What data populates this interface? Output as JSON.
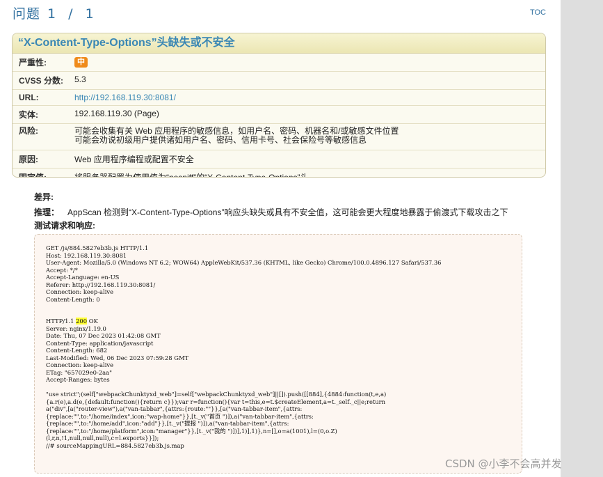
{
  "header": {
    "title": "问题",
    "counter": "1 / 1",
    "toc_label": "TOC"
  },
  "issue": {
    "title": "“X-Content-Type-Options”头缺失或不安全",
    "rows": {
      "severity": {
        "label": "严重性:",
        "value": "中"
      },
      "cvss": {
        "label": "CVSS 分数:",
        "value": "5.3"
      },
      "url": {
        "label": "URL:",
        "value": "http://192.168.119.30:8081/"
      },
      "entity": {
        "label": "实体:",
        "value": "192.168.119.30 (Page)"
      },
      "risk": {
        "label": "风险:",
        "line1": "可能会收集有关 Web 应用程序的敏感信息，如用户名、密码、机器名和/或敏感文件位置",
        "line2": "可能会劝说初级用户提供诸如用户名、密码、信用卡号、社会保险号等敏感信息"
      },
      "cause": {
        "label": "原因:",
        "value": "Web 应用程序编程或配置不安全"
      },
      "fix": {
        "label": "固定值:",
        "value": "将服务器配置为使用值为“nosniff”的“X-Content-Type-Options”头"
      }
    }
  },
  "diff": {
    "label": "差异:"
  },
  "reasoning": {
    "label": "推理：",
    "text": "AppScan 检测到“X-Content-Type-Options”响应头缺失或具有不安全值，这可能会更大程度地暴露于偷渡式下载攻击之下"
  },
  "test": {
    "label": "测试请求和响应:"
  },
  "request": {
    "lines": [
      "GET /js/884.5827eb3b.js HTTP/1.1",
      "Host: 192.168.119.30:8081",
      "User-Agent: Mozilla/5.0 (Windows NT 6.2; WOW64) AppleWebKit/537.36 (KHTML, like Gecko) Chrome/100.0.4896.127 Safari/537.36",
      "Accept: */*",
      "Accept-Language: en-US",
      "Referer: http://192.168.119.30:8081/",
      "Connection: keep-alive",
      "Content-Length: 0"
    ]
  },
  "response": {
    "status_prefix": "HTTP/1.1 ",
    "status_code": "200",
    "status_suffix": " OK",
    "headers": [
      "Server: nginx/1.19.0",
      "Date: Thu, 07 Dec 2023 01:42:08 GMT",
      "Content-Type: application/javascript",
      "Content-Length: 682",
      "Last-Modified: Wed, 06 Dec 2023 07:59:28 GMT",
      "Connection: keep-alive",
      "ETag: \"657029e0-2aa\"",
      "Accept-Ranges: bytes"
    ],
    "body": [
      "\"use strict\";(self[\"webpackChunktyxd_web\"]=self[\"webpackChunktyxd_web\"]||[]).push([[884],{4884:function(t,e,a)",
      "{a.r(e),a.d(e,{default:function(){return c}});var r=function(){var t=this,e=t.$createElement,a=t._self._c||e;return",
      "a(\"div\",[a(\"router-view\"),a(\"van-tabbar\",{attrs:{route:\"\"}},[a(\"van-tabbar-item\",{attrs:",
      "{replace:\"\",to:\"/home/index\",icon:\"wap-home\"}},[t._v(\"首页 \")]),a(\"van-tabbar-item\",{attrs:",
      "{replace:\"\",to:\"/home/add\",icon:\"add\"}},[t._v(\"提报 \")]),a(\"van-tabbar-item\",{attrs:",
      "{replace:\"\",to:\"/home/platform\",icon:\"manager\"}},[t._v(\"我的 \")])],1)],1)},n=[],o=a(1001),l=(0,o.Z)",
      "(l,r,n,!1,null,null,null),c=l.exports}}]);",
      "//# sourceMappingURL=884.5827eb3b.js.map"
    ]
  },
  "watermark": "CSDN @小李不会高并发",
  "colors": {
    "accent": "#3a87b4",
    "severity_badge": "#ef8a1a",
    "highlight": "#ffff33"
  }
}
